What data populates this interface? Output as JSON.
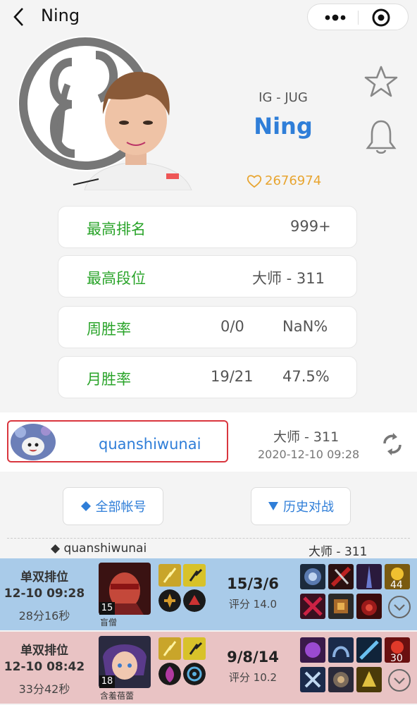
{
  "header": {
    "title": "Ning"
  },
  "player": {
    "team_pos": "IG - JUG",
    "name": "Ning",
    "likes": "2676974"
  },
  "stats": [
    {
      "label": "最高排名",
      "value1": "",
      "value2": "999+"
    },
    {
      "label": "最高段位",
      "value1": "",
      "value2": "大师 - 311"
    },
    {
      "label": "周胜率",
      "value1": "0/0",
      "value2": "NaN%"
    },
    {
      "label": "月胜率",
      "value1": "19/21",
      "value2": "47.5%"
    }
  ],
  "account": {
    "name": "quanshiwunai",
    "rank": "大师 - 311",
    "updated": "2020-12-10 09:28"
  },
  "buttons": {
    "all_accounts": "全部帐号",
    "history": "历史对战"
  },
  "list_header": {
    "account": "quanshiwunai",
    "rank": "大师 - 311"
  },
  "matches": [
    {
      "result": "win",
      "queue": "单双排位",
      "date": "12-10 09:28",
      "duration": "28分16秒",
      "champion": "盲僧",
      "level": "15",
      "kda": "15/3/6",
      "score_label": "评分 14.0",
      "gold": "44"
    },
    {
      "result": "loss",
      "queue": "单双排位",
      "date": "12-10 08:42",
      "duration": "33分42秒",
      "champion": "含羞蓓蕾",
      "level": "18",
      "kda": "9/8/14",
      "score_label": "评分 10.2",
      "gold": "30"
    }
  ],
  "colors": {
    "win_bg": "#a9cbe9",
    "loss_bg": "#e9c3c4",
    "accent_blue": "#2f7ed8",
    "green": "#2aa42a",
    "gold": "#e8a530",
    "highlight_red": "#d9363e"
  },
  "icons": [
    "back-icon",
    "more-icon",
    "close-target-icon",
    "star-icon",
    "bell-icon",
    "heart-icon",
    "refresh-icon",
    "diamond-icon",
    "triangle-down-icon",
    "chevron-down-icon"
  ]
}
